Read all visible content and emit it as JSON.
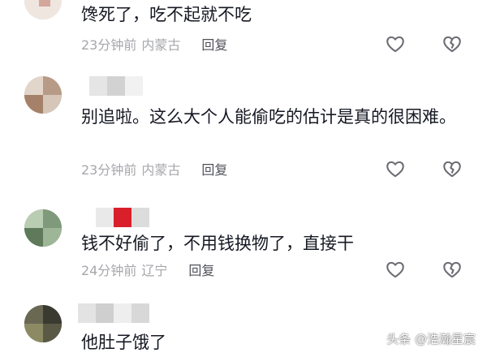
{
  "comments": [
    {
      "text": "馋死了，吃不起就不吃",
      "time": "23分钟前",
      "location": "内蒙古",
      "reply_label": "回复",
      "like_icon": "heart-outline-icon",
      "dislike_icon": "broken-heart-icon"
    },
    {
      "text": "别追啦。这么大个人能偷吃的估计是真的很困难。",
      "time": "23分钟前",
      "location": "内蒙古",
      "reply_label": "回复",
      "like_icon": "heart-outline-icon",
      "dislike_icon": "broken-heart-icon"
    },
    {
      "text": "钱不好偷了，不用钱换物了，直接干",
      "time": "24分钟前",
      "location": "辽宁",
      "reply_label": "回复",
      "like_icon": "heart-outline-icon",
      "dislike_icon": "broken-heart-icon"
    },
    {
      "text": "他肚子饿了"
    }
  ],
  "watermark": "头条 @浩瀚星宸",
  "colors": {
    "text": "#161823",
    "meta": "#a6a7ab",
    "reply": "#505158",
    "icon": "#6b6c72"
  }
}
